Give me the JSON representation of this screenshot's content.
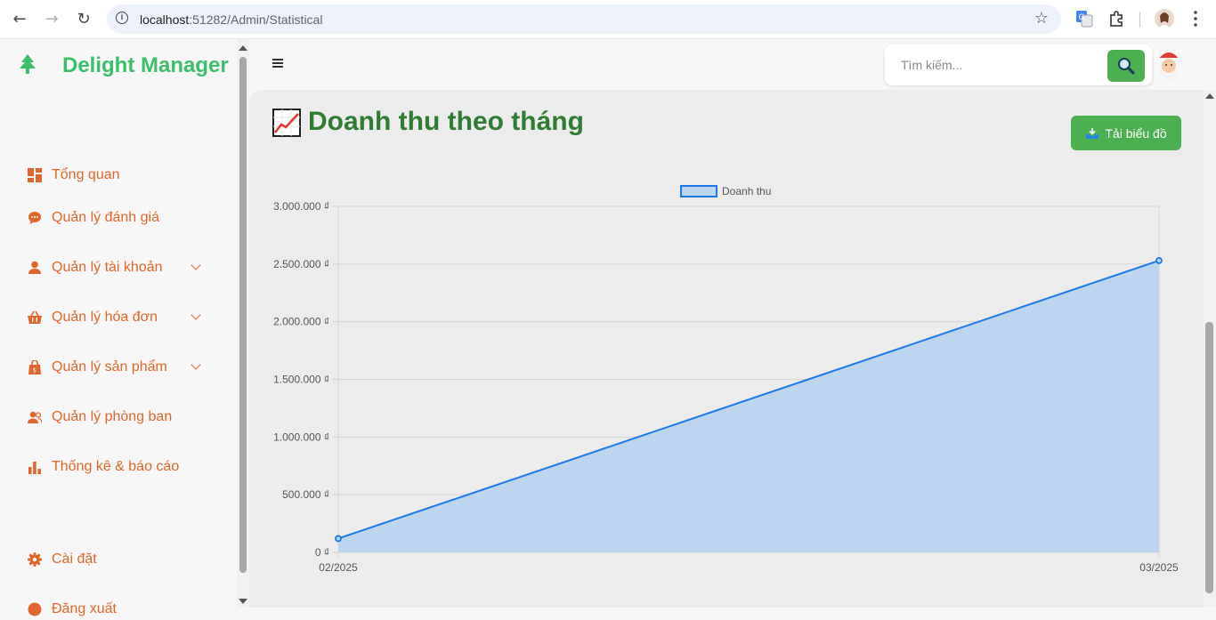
{
  "browser": {
    "url_host": "localhost",
    "url_rest": ":51282/Admin/Statistical"
  },
  "sidebar": {
    "brand": "Delight Manager",
    "items": [
      {
        "label": "Tổng quan",
        "icon": "dashboard-icon"
      },
      {
        "label": "Quản lý đánh giá",
        "icon": "comment-icon"
      },
      {
        "label": "Quản lý tài khoản",
        "icon": "user-icon"
      },
      {
        "label": "Quản lý hóa đơn",
        "icon": "basket-icon"
      },
      {
        "label": "Quản lý sản phẩm",
        "icon": "shopping-bag-icon"
      },
      {
        "label": "Quản lý phòng ban",
        "icon": "users-icon"
      },
      {
        "label": "Thống kê & báo cáo",
        "icon": "bar-chart-icon"
      },
      {
        "label": "Cài đặt",
        "icon": "gear-icon"
      },
      {
        "label": "Đăng xuất",
        "icon": "logout-icon"
      }
    ]
  },
  "search": {
    "placeholder": "Tìm kiếm..."
  },
  "page": {
    "title": "Doanh thu theo tháng",
    "download_label": "Tải biểu đồ"
  },
  "colors": {
    "accent_green": "#4caf50",
    "title_green": "#2e7d32",
    "brand_green": "#3bbf6a",
    "menu_orange": "#e0662b",
    "line_blue": "#1a7ae8",
    "fill_blue": "#bcd6f0"
  },
  "chart_data": {
    "type": "area",
    "x": [
      "02/2025",
      "03/2025"
    ],
    "series": [
      {
        "name": "Doanh thu",
        "values": [
          120000,
          2530000
        ]
      }
    ],
    "ylim": [
      0,
      3000000
    ],
    "yticks": [
      0,
      500000,
      1000000,
      1500000,
      2000000,
      2500000,
      3000000
    ],
    "ytick_labels": [
      "0 ₫",
      "500.000 ₫",
      "1.000.000 ₫",
      "1.500.000 ₫",
      "2.000.000 ₫",
      "2.500.000 ₫",
      "3.000.000 ₫"
    ],
    "grid": true,
    "legend": "top-center"
  }
}
